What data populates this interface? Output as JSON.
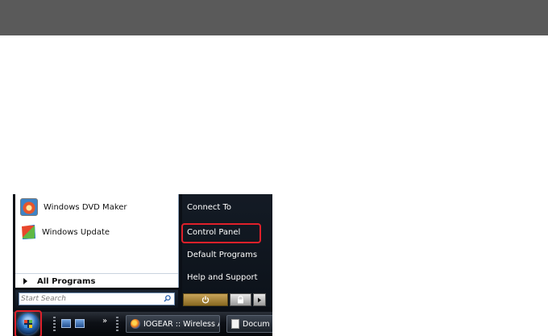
{
  "start_menu": {
    "programs": [
      {
        "label": "Windows DVD Maker",
        "icon": "dvd-maker-icon"
      },
      {
        "label": "Windows Update",
        "icon": "windows-update-icon"
      }
    ],
    "all_programs_label": "All Programs",
    "search_placeholder": "Start Search",
    "right_items": [
      {
        "label": "Connect To"
      },
      {
        "label": "Control Panel",
        "highlighted": true
      },
      {
        "label": "Default Programs"
      },
      {
        "label": "Help and Support"
      }
    ],
    "power": {
      "shutdown_icon": "power-icon",
      "lock_icon": "lock-icon",
      "options_icon": "arrow-right-icon"
    }
  },
  "taskbar": {
    "chevron": "»",
    "buttons": [
      {
        "label": "IOGEAR :: Wireless A...",
        "icon": "firefox-icon"
      },
      {
        "label": "Docum",
        "icon": "document-icon"
      }
    ]
  },
  "colors": {
    "highlight": "#e0202a",
    "top_bar": "#5a5a5a"
  }
}
